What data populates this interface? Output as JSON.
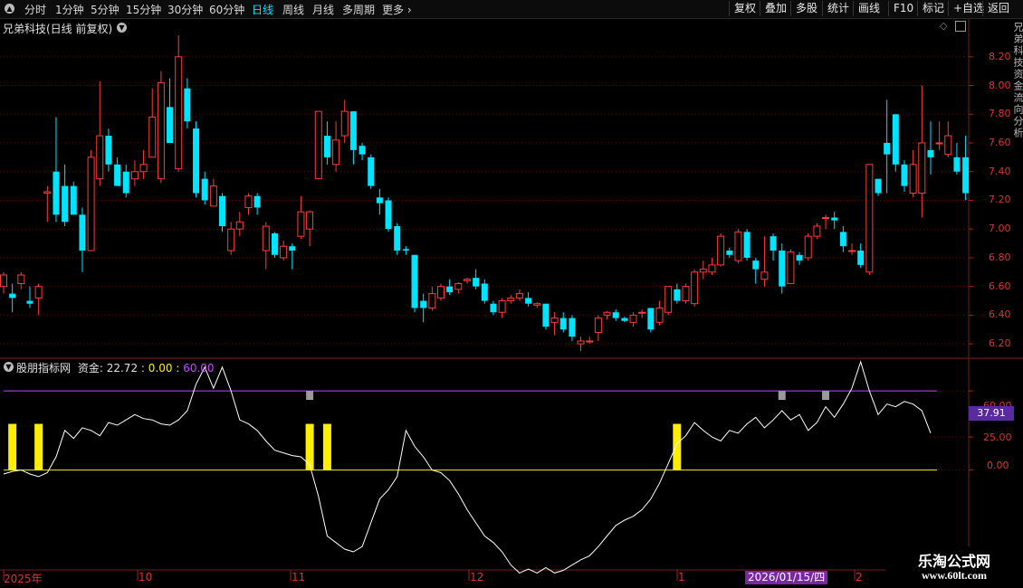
{
  "toolbar": {
    "timeframes": [
      "分时",
      "1分钟",
      "5分钟",
      "15分钟",
      "30分钟",
      "60分钟",
      "日线",
      "周线",
      "月线",
      "多周期",
      "更多"
    ],
    "active_timeframe": "日线",
    "buttons": [
      "复权",
      "叠加",
      "多股",
      "统计",
      "画线",
      "F10",
      "标记",
      "+自选",
      "返回"
    ]
  },
  "main_panel": {
    "title": "兄弟科技(日线 前复权)",
    "y_ticks": [
      "8.20",
      "8.00",
      "7.80",
      "7.60",
      "7.40",
      "7.20",
      "7.00",
      "6.80",
      "6.60",
      "6.40",
      "6.20"
    ]
  },
  "indicator_panel": {
    "name": "股朋指标网",
    "label_zijin": "资金:",
    "value_zijin": "22.72",
    "sep1": ":",
    "value_zero": "0.00",
    "sep2": ":",
    "value_sixty": "60.00",
    "y_ticks": [
      "60.00",
      "25.00",
      "0.00"
    ],
    "current_value_box": "37.91"
  },
  "x_axis": {
    "labels": [
      "2025年",
      "10",
      "11",
      "12",
      "1",
      "2"
    ],
    "cursor_date": "2026/01/15/四"
  },
  "watermark": {
    "line1": "乐淘公式网",
    "line2": "www.60lt.com"
  },
  "right_column_text": "兄弟科技资金流向分析",
  "colors": {
    "up": "#ff3b3b",
    "down": "#00e5ff",
    "signal_bar": "#ffee00",
    "gray_marker": "#9a9a9a",
    "upper_line": "#cc44ff",
    "zero_line": "#ffee00",
    "indicator_line": "#ffffff"
  },
  "chart_data": {
    "type": "candlestick",
    "ylim": [
      6.1,
      8.35
    ],
    "candles": [
      [
        6.6,
        6.68,
        6.7,
        6.55
      ],
      [
        6.55,
        6.52,
        6.62,
        6.42
      ],
      [
        6.62,
        6.68,
        6.7,
        6.58
      ],
      [
        6.5,
        6.48,
        6.6,
        6.45
      ],
      [
        6.52,
        6.6,
        6.62,
        6.4
      ],
      [
        7.25,
        7.26,
        7.3,
        7.05
      ],
      [
        7.4,
        7.1,
        7.78,
        7.05
      ],
      [
        7.3,
        7.05,
        7.45,
        7.02
      ],
      [
        7.3,
        7.1,
        7.33,
        7.1
      ],
      [
        7.1,
        6.85,
        7.15,
        6.7
      ],
      [
        6.85,
        7.5,
        7.55,
        6.85
      ],
      [
        7.35,
        7.65,
        8.03,
        7.3
      ],
      [
        7.65,
        7.45,
        7.7,
        7.4
      ],
      [
        7.45,
        7.3,
        7.5,
        7.3
      ],
      [
        7.4,
        7.25,
        7.45,
        7.22
      ],
      [
        7.35,
        7.4,
        7.48,
        7.3
      ],
      [
        7.4,
        7.45,
        7.55,
        7.35
      ],
      [
        7.5,
        7.78,
        7.98,
        7.5
      ],
      [
        7.35,
        8.02,
        8.1,
        7.32
      ],
      [
        7.85,
        7.6,
        8.05,
        7.6
      ],
      [
        7.42,
        8.2,
        8.35,
        7.4
      ],
      [
        7.98,
        7.75,
        8.05,
        7.7
      ],
      [
        7.7,
        7.25,
        7.75,
        7.22
      ],
      [
        7.35,
        7.2,
        7.4,
        7.17
      ],
      [
        7.16,
        7.3,
        7.35,
        7.16
      ],
      [
        7.23,
        7.02,
        7.25,
        6.98
      ],
      [
        6.85,
        7.0,
        7.05,
        6.82
      ],
      [
        7.0,
        7.05,
        7.12,
        6.95
      ],
      [
        7.15,
        7.23,
        7.25,
        7.1
      ],
      [
        7.23,
        7.15,
        7.25,
        7.1
      ],
      [
        6.85,
        7.02,
        7.05,
        6.72
      ],
      [
        6.97,
        6.82,
        6.98,
        6.8
      ],
      [
        6.8,
        6.88,
        6.92,
        6.78
      ],
      [
        6.88,
        6.85,
        6.9,
        6.72
      ],
      [
        6.95,
        7.12,
        7.23,
        6.93
      ],
      [
        7.0,
        7.12,
        7.13,
        6.88
      ],
      [
        7.35,
        7.82,
        7.82,
        7.35
      ],
      [
        7.65,
        7.5,
        7.75,
        7.45
      ],
      [
        7.45,
        7.62,
        7.75,
        7.4
      ],
      [
        7.65,
        7.82,
        7.9,
        7.6
      ],
      [
        7.82,
        7.55,
        7.82,
        7.45
      ],
      [
        7.58,
        7.52,
        7.6,
        7.48
      ],
      [
        7.5,
        7.3,
        7.52,
        7.28
      ],
      [
        7.22,
        7.18,
        7.28,
        7.1
      ],
      [
        7.2,
        7.0,
        7.22,
        6.98
      ],
      [
        7.02,
        6.85,
        7.04,
        6.82
      ],
      [
        6.86,
        6.85,
        6.88,
        6.82
      ],
      [
        6.82,
        6.45,
        6.82,
        6.42
      ],
      [
        6.5,
        6.45,
        6.55,
        6.35
      ],
      [
        6.45,
        6.55,
        6.6,
        6.43
      ],
      [
        6.52,
        6.6,
        6.62,
        6.5
      ],
      [
        6.6,
        6.56,
        6.65,
        6.54
      ],
      [
        6.58,
        6.62,
        6.63,
        6.55
      ],
      [
        6.64,
        6.65,
        6.66,
        6.62
      ],
      [
        6.66,
        6.6,
        6.72,
        6.58
      ],
      [
        6.62,
        6.5,
        6.65,
        6.48
      ],
      [
        6.48,
        6.42,
        6.5,
        6.4
      ],
      [
        6.42,
        6.5,
        6.52,
        6.38
      ],
      [
        6.5,
        6.52,
        6.54,
        6.48
      ],
      [
        6.52,
        6.55,
        6.58,
        6.5
      ],
      [
        6.52,
        6.48,
        6.56,
        6.46
      ],
      [
        6.47,
        6.48,
        6.49,
        6.45
      ],
      [
        6.48,
        6.32,
        6.48,
        6.3
      ],
      [
        6.35,
        6.38,
        6.42,
        6.26
      ],
      [
        6.38,
        6.3,
        6.42,
        6.28
      ],
      [
        6.38,
        6.25,
        6.4,
        6.22
      ],
      [
        6.2,
        6.22,
        6.25,
        6.15
      ],
      [
        6.22,
        6.22,
        6.25,
        6.2
      ],
      [
        6.28,
        6.38,
        6.4,
        6.22
      ],
      [
        6.4,
        6.42,
        6.43,
        6.37
      ],
      [
        6.42,
        6.38,
        6.44,
        6.36
      ],
      [
        6.38,
        6.36,
        6.39,
        6.35
      ],
      [
        6.35,
        6.4,
        6.42,
        6.32
      ],
      [
        6.42,
        6.42,
        6.44,
        6.38
      ],
      [
        6.45,
        6.3,
        6.45,
        6.28
      ],
      [
        6.35,
        6.45,
        6.5,
        6.33
      ],
      [
        6.42,
        6.6,
        6.6,
        6.4
      ],
      [
        6.58,
        6.5,
        6.62,
        6.48
      ],
      [
        6.5,
        6.6,
        6.62,
        6.48
      ],
      [
        6.48,
        6.7,
        6.72,
        6.46
      ],
      [
        6.7,
        6.72,
        6.78,
        6.65
      ],
      [
        6.7,
        6.75,
        6.8,
        6.68
      ],
      [
        6.75,
        6.95,
        6.97,
        6.74
      ],
      [
        6.85,
        6.82,
        6.87,
        6.8
      ],
      [
        6.78,
        6.98,
        7.0,
        6.76
      ],
      [
        6.98,
        6.8,
        7.0,
        6.78
      ],
      [
        6.78,
        6.72,
        6.8,
        6.62
      ],
      [
        6.65,
        6.7,
        6.95,
        6.6
      ],
      [
        6.95,
        6.85,
        6.97,
        6.78
      ],
      [
        6.85,
        6.6,
        6.9,
        6.55
      ],
      [
        6.62,
        6.84,
        6.86,
        6.62
      ],
      [
        6.82,
        6.78,
        6.84,
        6.75
      ],
      [
        6.8,
        6.95,
        6.97,
        6.78
      ],
      [
        6.95,
        7.02,
        7.04,
        6.93
      ],
      [
        7.08,
        7.08,
        7.1,
        7.0
      ],
      [
        7.08,
        7.06,
        7.12,
        7.0
      ],
      [
        6.98,
        6.88,
        7.02,
        6.84
      ],
      [
        6.85,
        6.85,
        6.9,
        6.82
      ],
      [
        6.85,
        6.75,
        6.9,
        6.73
      ],
      [
        6.7,
        7.45,
        7.45,
        6.68
      ],
      [
        7.35,
        7.25,
        7.35,
        7.23
      ],
      [
        7.6,
        7.52,
        7.9,
        7.25
      ],
      [
        7.8,
        7.45,
        7.8,
        7.4
      ],
      [
        7.45,
        7.3,
        7.48,
        7.26
      ],
      [
        7.25,
        7.45,
        7.55,
        7.22
      ],
      [
        7.25,
        7.6,
        8.0,
        7.08
      ],
      [
        7.55,
        7.5,
        7.75,
        7.38
      ],
      [
        7.6,
        7.6,
        7.75,
        7.55
      ],
      [
        7.52,
        7.65,
        7.75,
        7.5
      ],
      [
        7.5,
        7.4,
        7.6,
        7.38
      ],
      [
        7.5,
        7.25,
        7.65,
        7.2
      ]
    ],
    "indicator": {
      "ylim": [
        -75,
        82
      ],
      "upper_line": 60,
      "zero_line": 0,
      "values": [
        -3,
        -1,
        0,
        -3,
        -5,
        -2,
        10,
        30,
        24,
        32,
        30,
        26,
        36,
        34,
        38,
        42,
        39,
        38,
        35,
        34,
        38,
        45,
        65,
        78,
        62,
        78,
        60,
        38,
        35,
        30,
        22,
        15,
        13,
        11,
        10,
        4,
        -20,
        -50,
        -55,
        -60,
        -62,
        -58,
        -40,
        -22,
        -15,
        -5,
        30,
        18,
        10,
        0,
        -2,
        -8,
        -18,
        -30,
        -40,
        -50,
        -55,
        -62,
        -72,
        -78,
        -75,
        -78,
        -74,
        -78,
        -76,
        -72,
        -68,
        -65,
        -58,
        -50,
        -42,
        -38,
        -35,
        -30,
        -22,
        -10,
        5,
        20,
        26,
        36,
        30,
        25,
        22,
        30,
        28,
        35,
        40,
        32,
        38,
        45,
        38,
        42,
        30,
        36,
        48,
        40,
        50,
        62,
        82,
        60,
        42,
        50,
        48,
        52,
        50,
        45,
        28
      ],
      "signal_bars": [
        1,
        4,
        35,
        37,
        77
      ],
      "gray_markers": [
        35,
        89,
        94
      ]
    }
  }
}
